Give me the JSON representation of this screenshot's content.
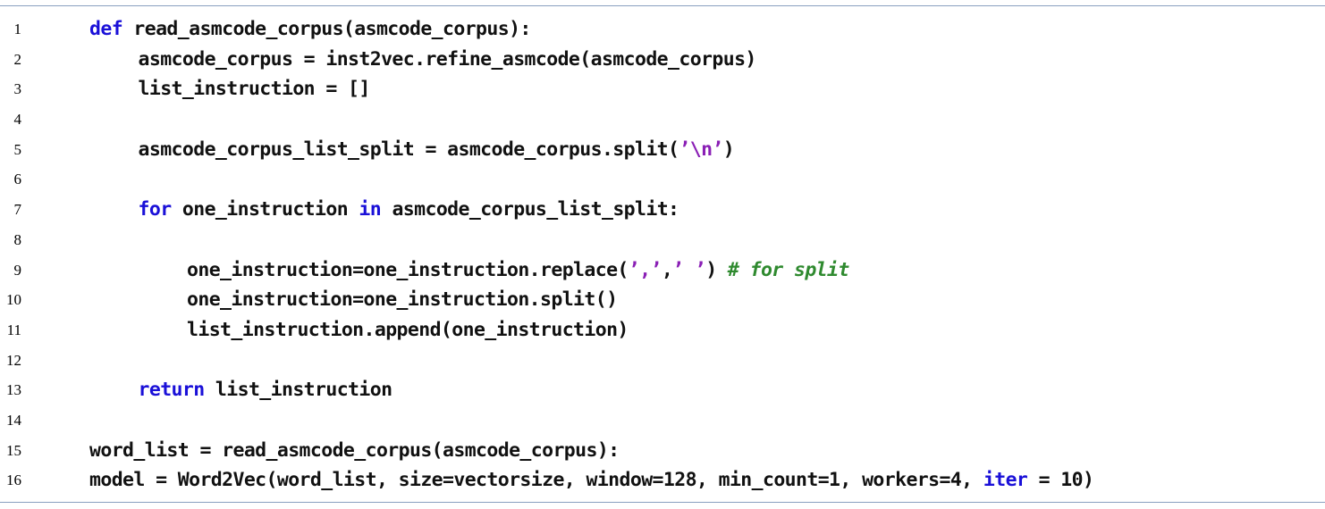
{
  "colors": {
    "keyword": "#1a10d8",
    "string": "#8a1fb5",
    "comment": "#2f8a2f",
    "text": "#111111",
    "rule": "#8aa0c0"
  },
  "lines": [
    {
      "no": "1",
      "indent": 0,
      "tokens": [
        {
          "t": "kw",
          "v": "def"
        },
        {
          "t": "txt",
          "v": " read_asmcode_corpus(asmcode_corpus):"
        }
      ]
    },
    {
      "no": "2",
      "indent": 1,
      "tokens": [
        {
          "t": "txt",
          "v": "asmcode_corpus = inst2vec.refine_asmcode(asmcode_corpus)"
        }
      ]
    },
    {
      "no": "3",
      "indent": 1,
      "tokens": [
        {
          "t": "txt",
          "v": "list_instruction = []"
        }
      ]
    },
    {
      "no": "4",
      "indent": 0,
      "tokens": []
    },
    {
      "no": "5",
      "indent": 1,
      "tokens": [
        {
          "t": "txt",
          "v": "asmcode_corpus_list_split = asmcode_corpus.split("
        },
        {
          "t": "str",
          "v": "’\\n’"
        },
        {
          "t": "txt",
          "v": ")"
        }
      ]
    },
    {
      "no": "6",
      "indent": 0,
      "tokens": []
    },
    {
      "no": "7",
      "indent": 1,
      "tokens": [
        {
          "t": "kw",
          "v": "for"
        },
        {
          "t": "txt",
          "v": " one_instruction "
        },
        {
          "t": "kw",
          "v": "in"
        },
        {
          "t": "txt",
          "v": " asmcode_corpus_list_split:"
        }
      ]
    },
    {
      "no": "8",
      "indent": 0,
      "tokens": []
    },
    {
      "no": "9",
      "indent": 2,
      "tokens": [
        {
          "t": "txt",
          "v": "one_instruction=one_instruction.replace("
        },
        {
          "t": "str",
          "v": "’,’"
        },
        {
          "t": "txt",
          "v": ","
        },
        {
          "t": "str",
          "v": "’ ’"
        },
        {
          "t": "txt",
          "v": ") "
        },
        {
          "t": "cm",
          "v": "# for split"
        }
      ]
    },
    {
      "no": "10",
      "indent": 2,
      "tokens": [
        {
          "t": "txt",
          "v": "one_instruction=one_instruction.split()"
        }
      ]
    },
    {
      "no": "11",
      "indent": 2,
      "tokens": [
        {
          "t": "txt",
          "v": "list_instruction.append(one_instruction)"
        }
      ]
    },
    {
      "no": "12",
      "indent": 0,
      "tokens": []
    },
    {
      "no": "13",
      "indent": 1,
      "tokens": [
        {
          "t": "kw",
          "v": "return"
        },
        {
          "t": "txt",
          "v": " list_instruction"
        }
      ]
    },
    {
      "no": "14",
      "indent": 0,
      "tokens": []
    },
    {
      "no": "15",
      "indent": 0,
      "tokens": [
        {
          "t": "txt",
          "v": "word_list = read_asmcode_corpus(asmcode_corpus):"
        }
      ]
    },
    {
      "no": "16",
      "indent": 0,
      "tokens": [
        {
          "t": "txt",
          "v": "model = Word2Vec(word_list, size=vectorsize, window=128, min_count=1, workers=4, "
        },
        {
          "t": "kw",
          "v": "iter"
        },
        {
          "t": "txt",
          "v": " = 10)"
        }
      ]
    }
  ]
}
